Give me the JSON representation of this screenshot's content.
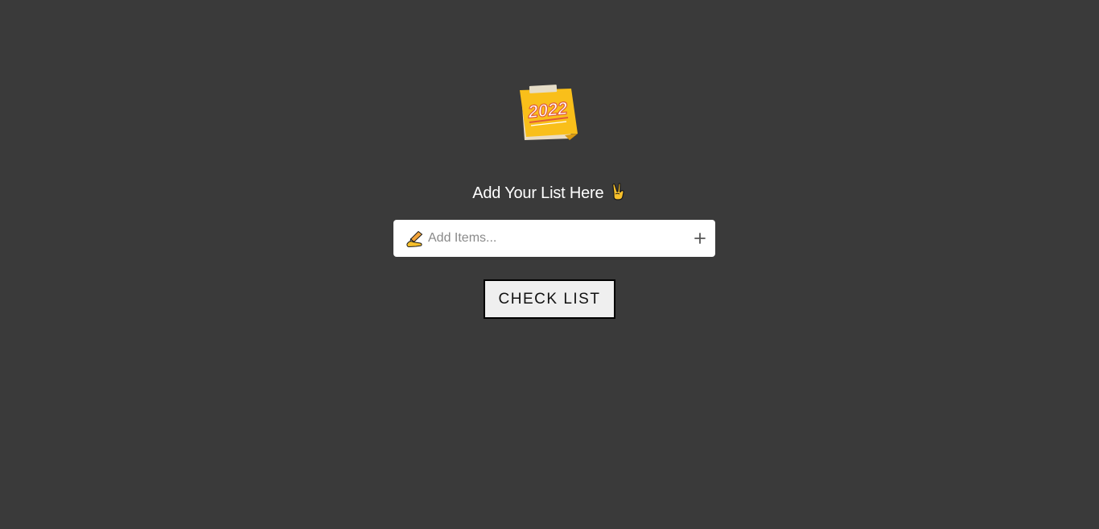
{
  "logo": {
    "icon": "sticky-note-2022-icon",
    "year_text": "2022",
    "colors": {
      "note": "#f9bf1a",
      "paper": "#eadcc2",
      "tape": "#e6ddc7",
      "year_stroke": "#e05a3a"
    }
  },
  "heading": {
    "text": "Add Your List Here",
    "emoji_icon": "victory-hand-icon"
  },
  "input": {
    "icon": "writing-hand-icon",
    "placeholder": "Add Items...",
    "value": "",
    "add_icon": "plus-icon"
  },
  "check_button": {
    "label": "CHECK LIST"
  },
  "colors": {
    "background": "#3a3a3a",
    "heading_text": "#ffffff",
    "input_background": "#ffffff",
    "button_background": "#efefef",
    "button_border": "#000000"
  }
}
